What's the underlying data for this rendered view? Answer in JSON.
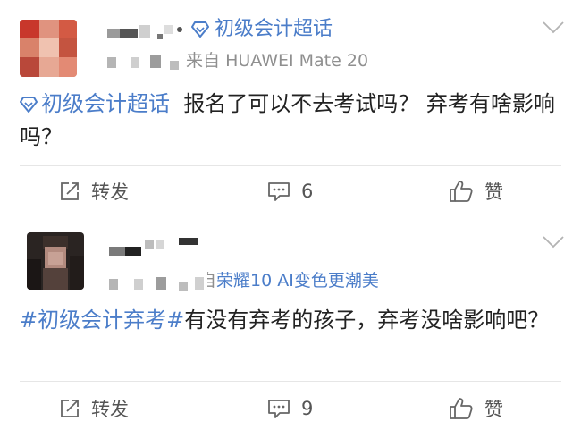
{
  "posts": [
    {
      "topic_badge": "初级会计超话",
      "meta_prefix": "来自",
      "meta_source": "HUAWEI Mate 20",
      "content_topic": "初级会计超话",
      "content_text": "报名了可以不去考试吗？ 弃考有啥影响吗？",
      "actions": {
        "repost": "转发",
        "comments": "6",
        "like": "赞"
      }
    },
    {
      "meta_prefix": "来自",
      "meta_source": "荣耀10 AI变色更潮美",
      "content_hashtag": "#初级会计弃考#",
      "content_text": "有没有弃考的孩子，弃考没啥影响吧？",
      "actions": {
        "repost": "转发",
        "comments": "9",
        "like": "赞"
      }
    }
  ],
  "colors": {
    "link": "#4b7dc9",
    "text": "#222222",
    "muted": "#8f8f8f",
    "divider": "#e6e6e6"
  },
  "icons": {
    "topic_badge": "diamond-icon",
    "repost": "repost-icon",
    "comment": "comment-icon",
    "like": "thumbs-up-icon",
    "menu": "chevron-down-icon"
  }
}
